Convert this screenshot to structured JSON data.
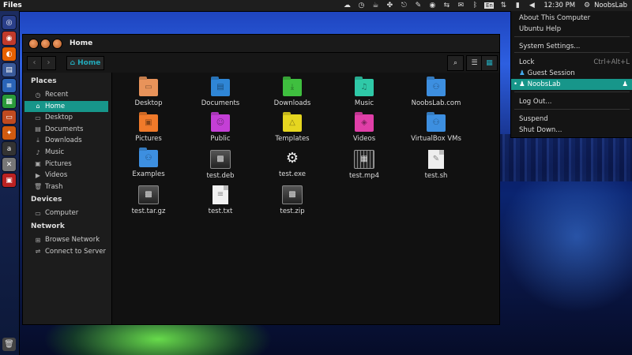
{
  "panel": {
    "app_title": "Files",
    "clock": "12:30 PM",
    "user_name": "NoobsLab",
    "indicators": [
      "cloud-icon",
      "clock-icon",
      "coffee-icon",
      "puzzle-icon",
      "paperclip-icon",
      "pen-icon",
      "eye-icon",
      "arrows-icon",
      "envelope-icon",
      "bluetooth-icon",
      "keyboard-icon",
      "network-icon",
      "battery-icon",
      "volume-icon"
    ],
    "keyboard_layout": "En"
  },
  "launcher": {
    "items": [
      {
        "icon": "ubuntu-logo-icon",
        "color": "#2a3f8a"
      },
      {
        "icon": "chrome-icon",
        "color": "#c03a2b"
      },
      {
        "icon": "firefox-icon",
        "color": "#e66000"
      },
      {
        "icon": "files-icon",
        "color": "#3a5a9a"
      },
      {
        "icon": "writer-icon",
        "color": "#2a64b8"
      },
      {
        "icon": "calc-icon",
        "color": "#2a9a3a"
      },
      {
        "icon": "impress-icon",
        "color": "#c04a20"
      },
      {
        "icon": "software-center-icon",
        "color": "#d05a10"
      },
      {
        "icon": "amazon-icon",
        "color": "#333333"
      },
      {
        "icon": "settings-icon",
        "color": "#777777"
      },
      {
        "icon": "workspace-icon",
        "color": "#bb2222"
      }
    ],
    "trash_icon": "trash-icon"
  },
  "window": {
    "title": "Home",
    "path_button": "Home"
  },
  "sidebar": {
    "sections": [
      {
        "heading": "Places",
        "items": [
          {
            "label": "Recent",
            "icon": "recent-icon",
            "active": false
          },
          {
            "label": "Home",
            "icon": "home-icon",
            "active": true
          },
          {
            "label": "Desktop",
            "icon": "desktop-icon",
            "active": false
          },
          {
            "label": "Documents",
            "icon": "documents-icon",
            "active": false
          },
          {
            "label": "Downloads",
            "icon": "downloads-icon",
            "active": false
          },
          {
            "label": "Music",
            "icon": "music-icon",
            "active": false
          },
          {
            "label": "Pictures",
            "icon": "pictures-icon",
            "active": false
          },
          {
            "label": "Videos",
            "icon": "videos-icon",
            "active": false
          },
          {
            "label": "Trash",
            "icon": "trash-icon",
            "active": false
          }
        ]
      },
      {
        "heading": "Devices",
        "items": [
          {
            "label": "Computer",
            "icon": "computer-icon",
            "active": false
          }
        ]
      },
      {
        "heading": "Network",
        "items": [
          {
            "label": "Browse Network",
            "icon": "network-icon",
            "active": false
          },
          {
            "label": "Connect to Server",
            "icon": "server-icon",
            "active": false
          }
        ]
      }
    ]
  },
  "files": [
    {
      "label": "Desktop",
      "type": "folder",
      "color": "#e8935a",
      "glyph": "desktop-icon"
    },
    {
      "label": "Documents",
      "type": "folder",
      "color": "#2f86d6",
      "glyph": "documents-icon"
    },
    {
      "label": "Downloads",
      "type": "folder",
      "color": "#3fbf3f",
      "glyph": "downloads-icon"
    },
    {
      "label": "Music",
      "type": "folder",
      "color": "#2fc9a8",
      "glyph": "music-icon"
    },
    {
      "label": "NoobsLab.com",
      "type": "folder",
      "color": "#3d8fe0",
      "glyph": "link-icon"
    },
    {
      "label": "Pictures",
      "type": "folder",
      "color": "#f07a2a",
      "glyph": "pictures-icon"
    },
    {
      "label": "Public",
      "type": "folder",
      "color": "#c43fd6",
      "glyph": "public-icon"
    },
    {
      "label": "Templates",
      "type": "folder",
      "color": "#e6d620",
      "glyph": "templates-icon"
    },
    {
      "label": "Videos",
      "type": "folder",
      "color": "#e03fa8",
      "glyph": "videos-icon"
    },
    {
      "label": "VirtualBox VMs",
      "type": "folder",
      "color": "#3d8fe0",
      "glyph": "link-icon"
    },
    {
      "label": "Examples",
      "type": "folder",
      "color": "#3d8fe0",
      "glyph": "link-icon"
    },
    {
      "label": "test.deb",
      "type": "package",
      "color": "#444444",
      "glyph": "package-icon"
    },
    {
      "label": "test.exe",
      "type": "executable",
      "color": "#111111",
      "glyph": "gear-icon"
    },
    {
      "label": "test.mp4",
      "type": "video",
      "color": "#333333",
      "glyph": "film-icon"
    },
    {
      "label": "test.sh",
      "type": "script",
      "color": "#eeeeee",
      "glyph": "script-icon"
    },
    {
      "label": "test.tar.gz",
      "type": "archive",
      "color": "#444444",
      "glyph": "archive-icon"
    },
    {
      "label": "test.txt",
      "type": "text",
      "color": "#f0f0f0",
      "glyph": "text-icon"
    },
    {
      "label": "test.zip",
      "type": "archive",
      "color": "#444444",
      "glyph": "archive-icon"
    }
  ],
  "session_menu": {
    "items": [
      {
        "label": "About This Computer"
      },
      {
        "label": "Ubuntu Help"
      },
      {
        "label": "System Settings..."
      },
      {
        "label": "Lock",
        "shortcut": "Ctrl+Alt+L"
      },
      {
        "label": "Guest Session",
        "user": true
      },
      {
        "label": "NoobsLab",
        "user": true,
        "active": true
      },
      {
        "label": "Log Out..."
      },
      {
        "label": "Suspend"
      },
      {
        "label": "Shut Down..."
      }
    ]
  },
  "colors": {
    "accent": "#17968a",
    "panel": "#1e1e1e",
    "window_bg": "#111111"
  }
}
